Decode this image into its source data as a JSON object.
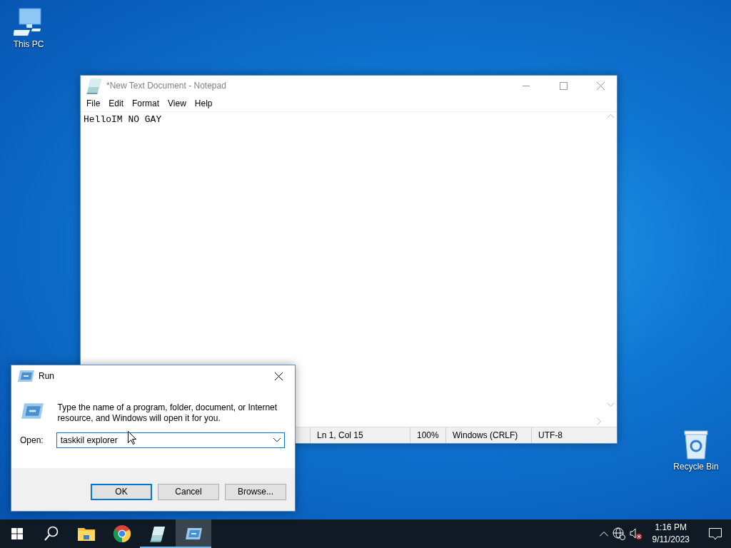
{
  "desktop_icons": [
    {
      "kind": "computer",
      "label": "This PC"
    },
    {
      "kind": "recycle",
      "label": "Recycle Bin"
    }
  ],
  "notepad": {
    "title": "*New Text Document - Notepad",
    "menu": [
      "File",
      "Edit",
      "Format",
      "View",
      "Help"
    ],
    "text": "HelloIM NO GAY",
    "status": [
      "Ln 1, Col 15",
      "100%",
      "Windows (CRLF)",
      "UTF-8"
    ]
  },
  "run_dialog": {
    "title": "Run",
    "description": "Type the name of a program, folder, document, or Internet resource, and Windows will open it for you.",
    "open_label": "Open:",
    "value": "taskkil explorer",
    "buttons": [
      {
        "label": "OK",
        "default": true
      },
      {
        "label": "Cancel",
        "default": false
      },
      {
        "label": "Browse...",
        "default": false
      }
    ]
  },
  "taskbar": {
    "apps": [
      {
        "kind": "explorer",
        "running": false,
        "selected": false
      },
      {
        "kind": "chrome",
        "running": false,
        "selected": false
      },
      {
        "kind": "notepad",
        "running": true,
        "selected": false
      },
      {
        "kind": "run",
        "running": true,
        "selected": true
      }
    ],
    "time": "1:16 PM",
    "date": "9/11/2023"
  }
}
